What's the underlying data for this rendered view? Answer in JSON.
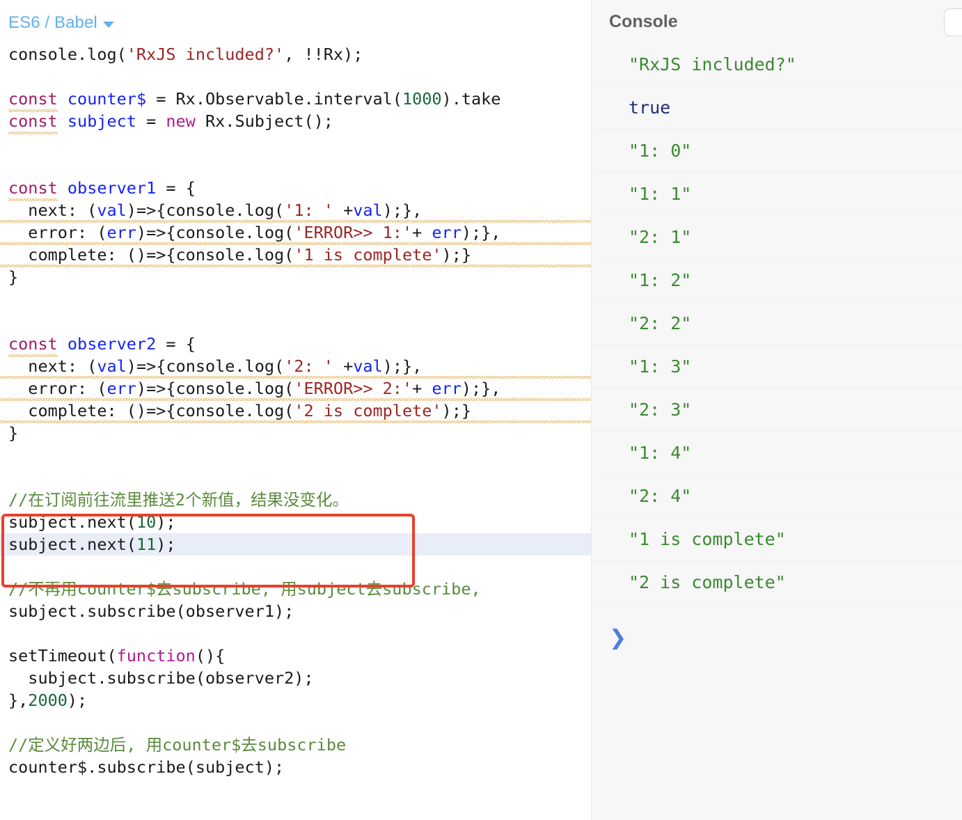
{
  "editor": {
    "mode_label": "ES6 / Babel",
    "caret_icon": "chevron-down-icon",
    "lines": [
      {
        "id": "l1",
        "segments": [
          {
            "t": "console.log(",
            "c": "plain"
          },
          {
            "t": "'RxJS included?'",
            "c": "str"
          },
          {
            "t": ", !!Rx);",
            "c": "plain"
          }
        ]
      },
      {
        "id": "l2",
        "segments": []
      },
      {
        "id": "l3",
        "segments": [
          {
            "t": "const",
            "c": "kw",
            "squiggle": true
          },
          {
            "t": " ",
            "c": "plain"
          },
          {
            "t": "counter$",
            "c": "var"
          },
          {
            "t": " = Rx.Observable.interval(",
            "c": "plain"
          },
          {
            "t": "1000",
            "c": "num"
          },
          {
            "t": ").take",
            "c": "plain"
          }
        ]
      },
      {
        "id": "l4",
        "segments": [
          {
            "t": "const",
            "c": "kw",
            "squiggle": true
          },
          {
            "t": " ",
            "c": "plain"
          },
          {
            "t": "subject",
            "c": "var"
          },
          {
            "t": " = ",
            "c": "plain"
          },
          {
            "t": "new",
            "c": "kw2"
          },
          {
            "t": " Rx.Subject();",
            "c": "plain"
          }
        ]
      },
      {
        "id": "l5",
        "segments": []
      },
      {
        "id": "l6",
        "segments": []
      },
      {
        "id": "l7",
        "segments": [
          {
            "t": "const",
            "c": "kw",
            "squiggle": true
          },
          {
            "t": " ",
            "c": "plain"
          },
          {
            "t": "observer1",
            "c": "var"
          },
          {
            "t": " = {",
            "c": "plain"
          }
        ]
      },
      {
        "id": "l8",
        "segments": [
          {
            "t": "  next: (",
            "c": "plain"
          },
          {
            "t": "val",
            "c": "var"
          },
          {
            "t": ")=>",
            "c": "plain",
            "squiggle_sm": true
          },
          {
            "t": "{console.log(",
            "c": "plain"
          },
          {
            "t": "'1: '",
            "c": "str"
          },
          {
            "t": " +",
            "c": "plain"
          },
          {
            "t": "val",
            "c": "var"
          },
          {
            "t": ");},",
            "c": "plain"
          }
        ]
      },
      {
        "id": "l9",
        "segments": [
          {
            "t": "  error: (",
            "c": "plain"
          },
          {
            "t": "err",
            "c": "var"
          },
          {
            "t": ")=>",
            "c": "plain",
            "squiggle_sm": true
          },
          {
            "t": "{console.log(",
            "c": "plain"
          },
          {
            "t": "'ERROR>> 1:'",
            "c": "str"
          },
          {
            "t": "+ ",
            "c": "plain"
          },
          {
            "t": "err",
            "c": "var"
          },
          {
            "t": ");},",
            "c": "plain"
          }
        ]
      },
      {
        "id": "l10",
        "segments": [
          {
            "t": "  complete: ()=>",
            "c": "plain",
            "squiggle_sm": true
          },
          {
            "t": "{console.log(",
            "c": "plain"
          },
          {
            "t": "'1 is complete'",
            "c": "str"
          },
          {
            "t": ");}",
            "c": "plain"
          }
        ]
      },
      {
        "id": "l11",
        "segments": [
          {
            "t": "}",
            "c": "plain"
          }
        ]
      },
      {
        "id": "l12",
        "segments": []
      },
      {
        "id": "l13",
        "segments": []
      },
      {
        "id": "l14",
        "segments": [
          {
            "t": "const",
            "c": "kw",
            "squiggle": true
          },
          {
            "t": " ",
            "c": "plain"
          },
          {
            "t": "observer2",
            "c": "var"
          },
          {
            "t": " = {",
            "c": "plain"
          }
        ]
      },
      {
        "id": "l15",
        "segments": [
          {
            "t": "  next: (",
            "c": "plain"
          },
          {
            "t": "val",
            "c": "var"
          },
          {
            "t": ")=>",
            "c": "plain",
            "squiggle_sm": true
          },
          {
            "t": "{console.log(",
            "c": "plain"
          },
          {
            "t": "'2: '",
            "c": "str"
          },
          {
            "t": " +",
            "c": "plain"
          },
          {
            "t": "val",
            "c": "var"
          },
          {
            "t": ");},",
            "c": "plain"
          }
        ]
      },
      {
        "id": "l16",
        "segments": [
          {
            "t": "  error: (",
            "c": "plain"
          },
          {
            "t": "err",
            "c": "var"
          },
          {
            "t": ")=>",
            "c": "plain",
            "squiggle_sm": true
          },
          {
            "t": "{console.log(",
            "c": "plain"
          },
          {
            "t": "'ERROR>> 2:'",
            "c": "str"
          },
          {
            "t": "+ ",
            "c": "plain"
          },
          {
            "t": "err",
            "c": "var"
          },
          {
            "t": ");},",
            "c": "plain"
          }
        ]
      },
      {
        "id": "l17",
        "segments": [
          {
            "t": "  complete: ()=>",
            "c": "plain",
            "squiggle_sm": true
          },
          {
            "t": "{console.log(",
            "c": "plain"
          },
          {
            "t": "'2 is complete'",
            "c": "str"
          },
          {
            "t": ");}",
            "c": "plain"
          }
        ]
      },
      {
        "id": "l18",
        "segments": [
          {
            "t": "}",
            "c": "plain"
          }
        ]
      },
      {
        "id": "l19",
        "segments": []
      },
      {
        "id": "l20",
        "segments": []
      },
      {
        "id": "l21",
        "segments": [
          {
            "t": "//在订阅前往流里推送2个新值，结果没变化。",
            "c": "cmt"
          }
        ]
      },
      {
        "id": "l22",
        "segments": [
          {
            "t": "subject.next(",
            "c": "plain"
          },
          {
            "t": "10",
            "c": "num"
          },
          {
            "t": ");",
            "c": "plain"
          }
        ]
      },
      {
        "id": "l23",
        "active": true,
        "segments": [
          {
            "t": "subject.next(",
            "c": "plain"
          },
          {
            "t": "11",
            "c": "num"
          },
          {
            "t": ");",
            "c": "plain"
          }
        ]
      },
      {
        "id": "l24",
        "segments": []
      },
      {
        "id": "l25",
        "segments": [
          {
            "t": "//不再用counter$去subscribe, 用subject去subscribe,",
            "c": "cmt"
          }
        ]
      },
      {
        "id": "l26",
        "segments": [
          {
            "t": "subject.subscribe(observer1);",
            "c": "plain"
          }
        ]
      },
      {
        "id": "l27",
        "segments": []
      },
      {
        "id": "l28",
        "segments": [
          {
            "t": "setTimeout(",
            "c": "plain"
          },
          {
            "t": "function",
            "c": "kw2"
          },
          {
            "t": "(){",
            "c": "plain"
          }
        ]
      },
      {
        "id": "l29",
        "segments": [
          {
            "t": "  subject.subscribe(observer2);",
            "c": "plain"
          }
        ]
      },
      {
        "id": "l30",
        "segments": [
          {
            "t": "},",
            "c": "plain"
          },
          {
            "t": "2000",
            "c": "num"
          },
          {
            "t": ");",
            "c": "plain"
          }
        ]
      },
      {
        "id": "l31",
        "segments": []
      },
      {
        "id": "l32",
        "segments": [
          {
            "t": "//定义好两边后, 用counter$去subscribe",
            "c": "cmt"
          }
        ]
      },
      {
        "id": "l33",
        "segments": [
          {
            "t": "counter$.subscribe(subject);",
            "c": "plain"
          }
        ]
      }
    ],
    "annotation_box": {
      "color": "#e8402a"
    }
  },
  "console": {
    "title": "Console",
    "menu_button_icon": "menu-button-icon",
    "entries": [
      {
        "text": "\"RxJS included?\"",
        "type": "string"
      },
      {
        "text": "true",
        "type": "boolean"
      },
      {
        "text": "\"1: 0\"",
        "type": "string"
      },
      {
        "text": "\"1: 1\"",
        "type": "string"
      },
      {
        "text": "\"2: 1\"",
        "type": "string"
      },
      {
        "text": "\"1: 2\"",
        "type": "string"
      },
      {
        "text": "\"2: 2\"",
        "type": "string"
      },
      {
        "text": "\"1: 3\"",
        "type": "string"
      },
      {
        "text": "\"2: 3\"",
        "type": "string"
      },
      {
        "text": "\"1: 4\"",
        "type": "string"
      },
      {
        "text": "\"2: 4\"",
        "type": "string"
      },
      {
        "text": "\"1 is complete\"",
        "type": "string"
      },
      {
        "text": "\"2 is complete\"",
        "type": "string"
      }
    ],
    "prompt": {
      "chevron_icon": "chevron-right-icon",
      "chevron_glyph": "❯",
      "input_value": "",
      "placeholder": ""
    }
  },
  "colors": {
    "accent_blue": "#62b0ef",
    "annotation_red": "#e8402a",
    "string_green": "#3a8a30",
    "boolean_blue": "#202b75",
    "comment_green": "#5a8a3c",
    "active_line": "#e8edf7"
  }
}
